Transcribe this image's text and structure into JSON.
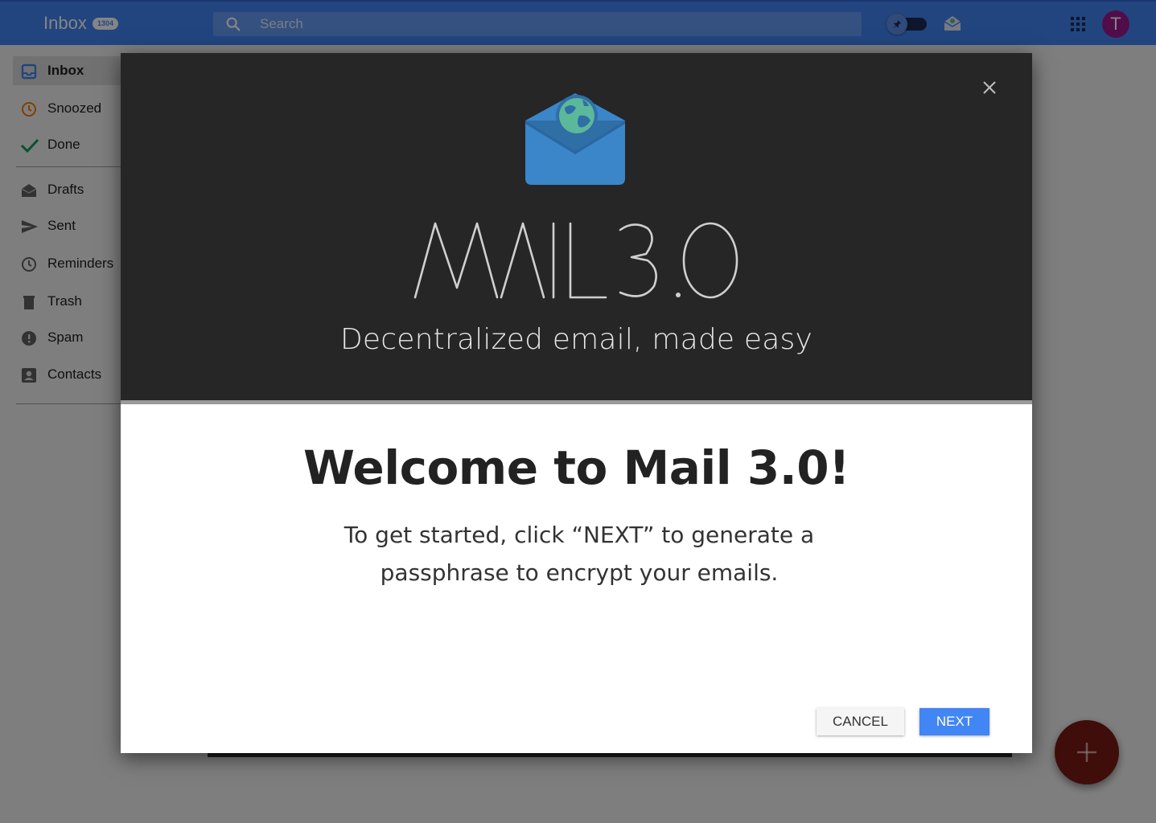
{
  "header": {
    "title": "Inbox",
    "unread_count": "1304",
    "search_placeholder": "Search",
    "avatar_initial": "T"
  },
  "sidebar": {
    "items": [
      {
        "label": "Inbox",
        "icon": "inbox-icon",
        "color": "#4285f4",
        "active": true
      },
      {
        "label": "Snoozed",
        "icon": "clock-icon",
        "color": "#f57c00"
      },
      {
        "label": "Done",
        "icon": "check-icon",
        "color": "#0f9d58"
      },
      {
        "label": "Drafts",
        "icon": "drafts-icon",
        "color": "#616161"
      },
      {
        "label": "Sent",
        "icon": "send-icon",
        "color": "#616161"
      },
      {
        "label": "Reminders",
        "icon": "reminder-clock-icon",
        "color": "#616161"
      },
      {
        "label": "Trash",
        "icon": "trash-icon",
        "color": "#616161"
      },
      {
        "label": "Spam",
        "icon": "spam-icon",
        "color": "#616161"
      },
      {
        "label": "Contacts",
        "icon": "contacts-icon",
        "color": "#616161"
      }
    ]
  },
  "modal": {
    "wordmark": "MAIL3.0",
    "tagline": "Decentralized email, made easy",
    "title": "Welcome to Mail 3.0!",
    "body": "To get started, click “NEXT” to generate a passphrase to encrypt your emails.",
    "cancel_label": "CANCEL",
    "next_label": "NEXT"
  },
  "colors": {
    "primary": "#4285f4",
    "hero_bg": "#262626",
    "envelope": "#3a86c8",
    "globe": "#5bb89a",
    "fab": "#c62828"
  }
}
